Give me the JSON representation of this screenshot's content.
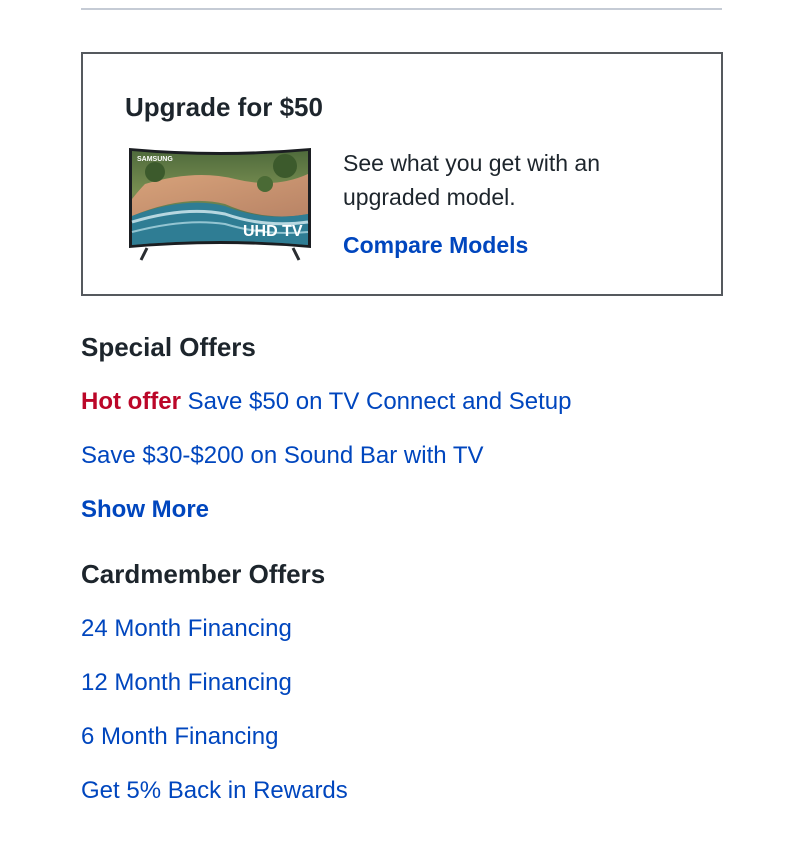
{
  "upgrade": {
    "title": "Upgrade for $50",
    "tv_brand": "SAMSUNG",
    "tv_badge": "UHD TV",
    "description": "See what you get with an upgraded model.",
    "compare_label": "Compare Models"
  },
  "special_offers": {
    "title": "Special Offers",
    "hot_label": "Hot offer",
    "items": [
      "Save $50 on TV Connect and Setup",
      "Save $30-$200 on Sound Bar with TV"
    ],
    "show_more": "Show More"
  },
  "cardmember_offers": {
    "title": "Cardmember Offers",
    "items": [
      "24 Month Financing",
      "12 Month Financing",
      "6 Month Financing",
      "Get 5% Back in Rewards"
    ]
  },
  "colors": {
    "link": "#0046be",
    "hot": "#bb0628",
    "text": "#1d252c"
  }
}
